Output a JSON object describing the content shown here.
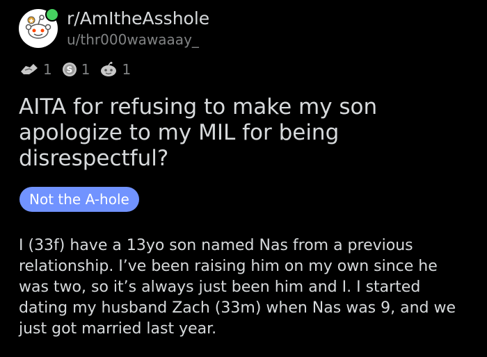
{
  "header": {
    "subreddit": "r/AmItheAsshole",
    "username": "u/thr000wawaaay_",
    "avatar_icon": "snoo-avatar-icon",
    "online_color": "#46d160"
  },
  "awards": [
    {
      "icon": "helpful-award-icon",
      "count": "1"
    },
    {
      "icon": "silver-award-icon",
      "count": "1"
    },
    {
      "icon": "wholesome-award-icon",
      "count": "1"
    }
  ],
  "post": {
    "title": "AITA for refusing to make my son apologize to my MIL for being disrespectful?",
    "flair": "Not the A-hole",
    "flair_color": "#7193ff",
    "body": "I (33f) have a 13yo son named Nas from a previous relationship. I’ve been raising him on my own since he was two, so it’s always just been him and I. I started dating my husband Zach (33m) when Nas was 9, and we just got married last year."
  }
}
